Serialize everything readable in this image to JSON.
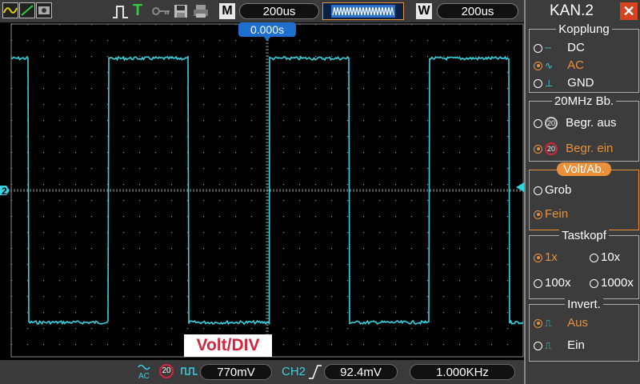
{
  "toolbar": {
    "timebase_label": "M",
    "timebase_value": "200us",
    "window_label": "W",
    "window_value": "200us",
    "trigger_marker": "T",
    "trigger_position": "0.000s"
  },
  "panel": {
    "title": "KAN.2",
    "coupling": {
      "title": "Kopplung",
      "options": [
        "DC",
        "AC",
        "GND"
      ],
      "selected": "AC"
    },
    "bandwidth": {
      "title": "20MHz  Bb.",
      "options": [
        "Begr.  aus",
        "Begr.  ein"
      ],
      "badge": "20",
      "selected": "Begr.  ein"
    },
    "volts": {
      "title": "Volt/Ab.",
      "options": [
        "Grob",
        "Fein"
      ],
      "selected": "Fein"
    },
    "probe": {
      "title": "Tastkopf",
      "options": [
        "1x",
        "10x",
        "100x",
        "1000x"
      ],
      "selected": "1x"
    },
    "invert": {
      "title": "Invert.",
      "options": [
        "Aus",
        "Ein"
      ],
      "selected": "Aus"
    }
  },
  "status": {
    "coupling_icon": "AC",
    "bw_badge": "20",
    "ch_volts": "770mV",
    "trigger_channel": "CH2",
    "trigger_level": "92.4mV",
    "frequency": "1.000KHz"
  },
  "overlay": {
    "label": "Volt/DIV"
  },
  "channel_marker": "2",
  "colors": {
    "trace": "#35d3e0",
    "accent": "#e8903a",
    "badge_red": "#d8243c",
    "pill_blue": "#1e6fd0"
  }
}
